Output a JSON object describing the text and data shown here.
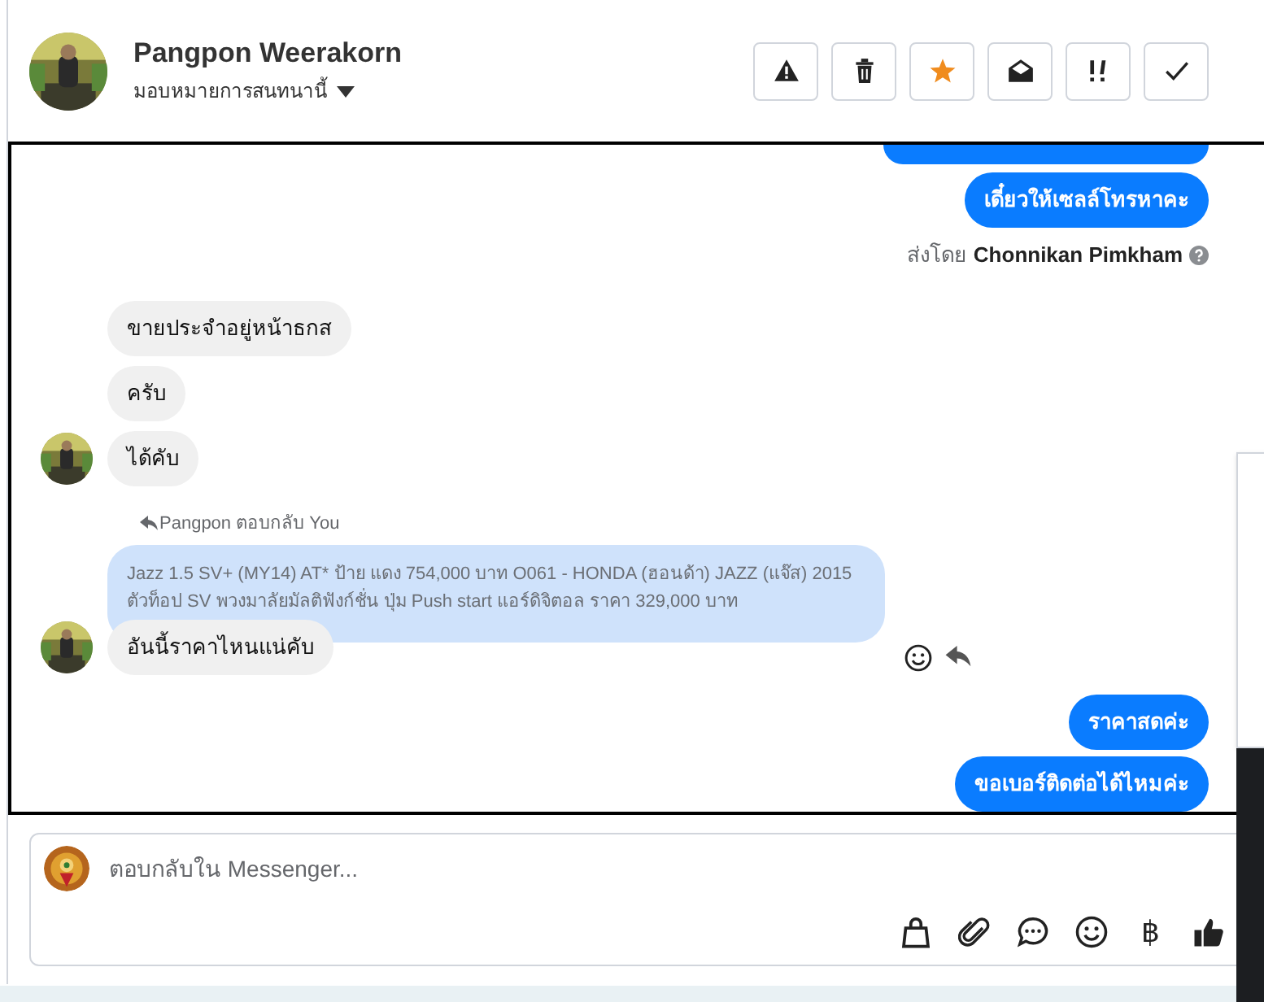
{
  "header": {
    "name": "Pangpon Weerakorn",
    "assign_label": "มอบหมายการสนทนานี้",
    "actions": [
      {
        "kind": "alert"
      },
      {
        "kind": "trash"
      },
      {
        "kind": "star"
      },
      {
        "kind": "envelope"
      },
      {
        "kind": "important"
      },
      {
        "kind": "check"
      }
    ]
  },
  "messages": [
    {
      "kind": "cut_outgoing"
    },
    {
      "kind": "outgoing",
      "text": "เดี๋ยวให้เซลล์โทรหาคะ"
    },
    {
      "kind": "sent_by",
      "prefix": "ส่งโดย",
      "name": "Chonnikan Pimkham"
    },
    {
      "kind": "incoming",
      "text": "ขายประจำอยู่หน้าธกส",
      "avatar": false
    },
    {
      "kind": "incoming",
      "text": "ครับ",
      "avatar": false
    },
    {
      "kind": "incoming",
      "text": "ได้คับ",
      "avatar": true
    },
    {
      "kind": "reply_note",
      "text": "Pangpon ตอบกลับ You"
    },
    {
      "kind": "quoted_reply",
      "quote": "Jazz 1.5 SV+ (MY14) AT* ป้าย แดง 754,000 บาท O061 - HONDA (ฮอนด้า) JAZZ (แจ๊ส) 2015 ตัวท็อป SV พวงมาลัยมัลติฟังก์ชั่น ปุ่ม Push start แอร์ดิจิตอล ราคา 329,000 บาท",
      "text": "อันนี้ราคาไหนแน่คับ"
    },
    {
      "kind": "outgoing",
      "text": "ราคาสดค่ะ"
    },
    {
      "kind": "outgoing",
      "text": "ขอเบอร์ติดต่อได้ไหมค่ะ"
    }
  ],
  "composer": {
    "placeholder": "ตอบกลับใน Messenger...",
    "tools": [
      {
        "kind": "bag"
      },
      {
        "kind": "clip"
      },
      {
        "kind": "chat"
      },
      {
        "kind": "smile"
      },
      {
        "kind": "text",
        "text": "฿"
      },
      {
        "kind": "like"
      }
    ]
  }
}
